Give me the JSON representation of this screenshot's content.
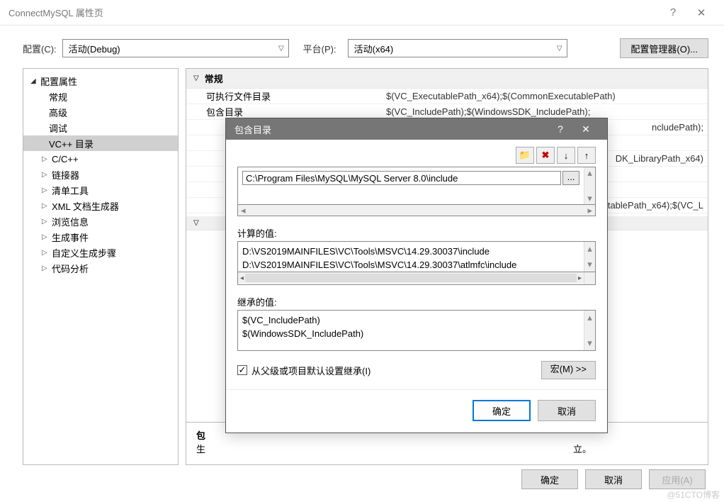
{
  "window": {
    "title": "ConnectMySQL 属性页",
    "help": "?",
    "close": "✕"
  },
  "config": {
    "config_label": "配置(C):",
    "config_value": "活动(Debug)",
    "platform_label": "平台(P):",
    "platform_value": "活动(x64)",
    "manager_btn": "配置管理器(O)..."
  },
  "tree": {
    "root": "配置属性",
    "items": [
      {
        "label": "常规",
        "expandable": false
      },
      {
        "label": "高级",
        "expandable": false
      },
      {
        "label": "调试",
        "expandable": false
      },
      {
        "label": "VC++ 目录",
        "expandable": false,
        "selected": true
      },
      {
        "label": "C/C++",
        "expandable": true
      },
      {
        "label": "链接器",
        "expandable": true
      },
      {
        "label": "清单工具",
        "expandable": true
      },
      {
        "label": "XML 文档生成器",
        "expandable": true
      },
      {
        "label": "浏览信息",
        "expandable": true
      },
      {
        "label": "生成事件",
        "expandable": true
      },
      {
        "label": "自定义生成步骤",
        "expandable": true
      },
      {
        "label": "代码分析",
        "expandable": true
      }
    ]
  },
  "props": {
    "section1": "常规",
    "rows": [
      {
        "name": "可执行文件目录",
        "value": "$(VC_ExecutablePath_x64);$(CommonExecutablePath)"
      },
      {
        "name": "包含目录",
        "value": "$(VC_IncludePath);$(WindowsSDK_IncludePath);"
      },
      {
        "name": "",
        "value": "ncludePath);"
      },
      {
        "name": "",
        "value": ""
      },
      {
        "name": "",
        "value": "DK_LibraryPath_x64)"
      },
      {
        "name": "",
        "value": ""
      },
      {
        "name": "",
        "value": ""
      },
      {
        "name": "",
        "value": "tablePath_x64);$(VC_L"
      }
    ],
    "desc_title": "包",
    "desc_text": "生",
    "desc_suffix": "立。"
  },
  "subdialog": {
    "title": "包含目录",
    "toolbar": {
      "folder": "📁",
      "delete": "✖",
      "down": "↓",
      "up": "↑"
    },
    "edit_value": "C:\\Program Files\\MySQL\\MySQL Server 8.0\\include",
    "browse": "...",
    "calc_label": "计算的值:",
    "calc_values": [
      "D:\\VS2019MAINFILES\\VC\\Tools\\MSVC\\14.29.30037\\include",
      "D:\\VS2019MAINFILES\\VC\\Tools\\MSVC\\14.29.30037\\atlmfc\\include"
    ],
    "inherit_label": "继承的值:",
    "inherit_values": [
      "$(VC_IncludePath)",
      "$(WindowsSDK_IncludePath)"
    ],
    "checkbox_label": "从父级或项目默认设置继承(I)",
    "checkbox_checked": "✓",
    "macro_btn": "宏(M) >>",
    "ok": "确定",
    "cancel": "取消"
  },
  "footer": {
    "ok": "确定",
    "cancel": "取消",
    "apply": "应用(A)"
  },
  "watermark": "@51CTO博客"
}
